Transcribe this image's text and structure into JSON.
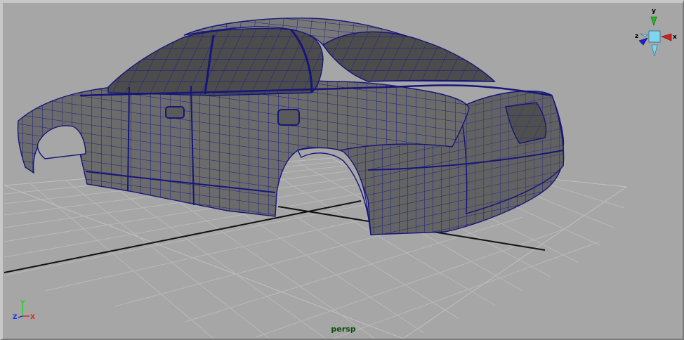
{
  "viewport": {
    "camera_name": "persp"
  },
  "view_cube": {
    "axis_y_label": "y",
    "axis_x_label": "x",
    "axis_z_label": "z",
    "colors": {
      "y": "#1fbf1f",
      "x": "#d02020",
      "z": "#2020d0",
      "cube": "#7fd4f0"
    }
  },
  "axis_triad": {
    "y_label": "Y",
    "x_label": "X",
    "z_label": "Z",
    "colors": {
      "y": "#22d022",
      "x": "#e02020",
      "z": "#2030e0"
    }
  },
  "scene": {
    "object": "car-body-mesh",
    "wire_color": "#18187e",
    "surface_color": "#6e6e6e",
    "grid_color": "#b8b8b8",
    "axis_line_color": "#101010"
  }
}
